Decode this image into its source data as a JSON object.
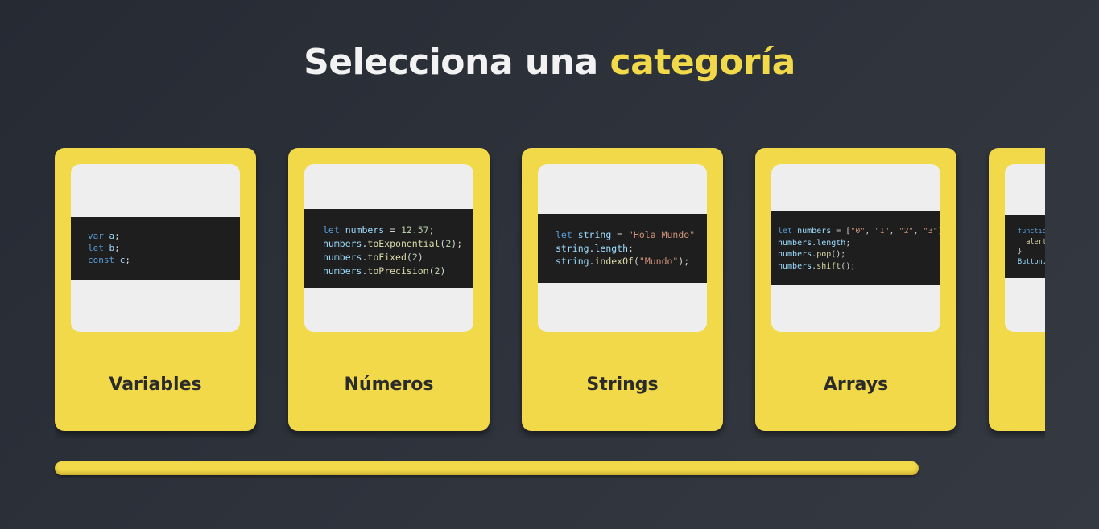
{
  "header": {
    "title_main": "Selecciona una ",
    "title_accent": "categoría"
  },
  "colors": {
    "background": "#2b2f37",
    "accent": "#f2d94a",
    "card_label": "#2b2b2b"
  },
  "categories": [
    {
      "label": "Variables",
      "code": [
        [
          {
            "t": "var",
            "c": "kw"
          },
          {
            "t": " a",
            "c": "var"
          },
          {
            "t": ";",
            "c": ""
          }
        ],
        [
          {
            "t": "let",
            "c": "kw"
          },
          {
            "t": " b",
            "c": "var"
          },
          {
            "t": ";",
            "c": ""
          }
        ],
        [
          {
            "t": "const",
            "c": "kw"
          },
          {
            "t": " c",
            "c": "var"
          },
          {
            "t": ";",
            "c": ""
          }
        ]
      ]
    },
    {
      "label": "Números",
      "code": [
        [
          {
            "t": "let",
            "c": "kw"
          },
          {
            "t": " numbers",
            "c": "var"
          },
          {
            "t": " = ",
            "c": ""
          },
          {
            "t": "12.57",
            "c": "num"
          },
          {
            "t": ";",
            "c": ""
          }
        ],
        [
          {
            "t": "numbers",
            "c": "var"
          },
          {
            "t": ".",
            "c": ""
          },
          {
            "t": "toExponential",
            "c": "fn"
          },
          {
            "t": "(",
            "c": ""
          },
          {
            "t": "2",
            "c": "num"
          },
          {
            "t": ");",
            "c": ""
          }
        ],
        [
          {
            "t": "numbers",
            "c": "var"
          },
          {
            "t": ".",
            "c": ""
          },
          {
            "t": "toFixed",
            "c": "fn"
          },
          {
            "t": "(",
            "c": ""
          },
          {
            "t": "2",
            "c": "num"
          },
          {
            "t": ")",
            "c": ""
          }
        ],
        [
          {
            "t": "numbers",
            "c": "var"
          },
          {
            "t": ".",
            "c": ""
          },
          {
            "t": "toPrecision",
            "c": "fn"
          },
          {
            "t": "(",
            "c": ""
          },
          {
            "t": "2",
            "c": "num"
          },
          {
            "t": ")",
            "c": ""
          }
        ]
      ]
    },
    {
      "label": "Strings",
      "code": [
        [
          {
            "t": "let",
            "c": "kw"
          },
          {
            "t": " string",
            "c": "var"
          },
          {
            "t": " = ",
            "c": ""
          },
          {
            "t": "\"Hola Mundo\"",
            "c": "str"
          }
        ],
        [
          {
            "t": "string",
            "c": "var"
          },
          {
            "t": ".",
            "c": ""
          },
          {
            "t": "length",
            "c": "var"
          },
          {
            "t": ";",
            "c": ""
          }
        ],
        [
          {
            "t": "string",
            "c": "var"
          },
          {
            "t": ".",
            "c": ""
          },
          {
            "t": "indexOf",
            "c": "fn"
          },
          {
            "t": "(",
            "c": ""
          },
          {
            "t": "\"Mundo\"",
            "c": "str"
          },
          {
            "t": ");",
            "c": ""
          }
        ]
      ]
    },
    {
      "label": "Arrays",
      "code": [
        [
          {
            "t": "let",
            "c": "kw"
          },
          {
            "t": " numbers",
            "c": "var"
          },
          {
            "t": " = [",
            "c": ""
          },
          {
            "t": "\"0\"",
            "c": "str"
          },
          {
            "t": ", ",
            "c": ""
          },
          {
            "t": "\"1\"",
            "c": "str"
          },
          {
            "t": ", ",
            "c": ""
          },
          {
            "t": "\"2\"",
            "c": "str"
          },
          {
            "t": ", ",
            "c": ""
          },
          {
            "t": "\"3\"",
            "c": "str"
          },
          {
            "t": "]",
            "c": ""
          }
        ],
        [
          {
            "t": "numbers",
            "c": "var"
          },
          {
            "t": ".",
            "c": ""
          },
          {
            "t": "length",
            "c": "var"
          },
          {
            "t": ";",
            "c": ""
          }
        ],
        [
          {
            "t": "numbers",
            "c": "var"
          },
          {
            "t": ".",
            "c": ""
          },
          {
            "t": "pop",
            "c": "fn"
          },
          {
            "t": "();",
            "c": ""
          }
        ],
        [
          {
            "t": "numbers",
            "c": "var"
          },
          {
            "t": ".",
            "c": ""
          },
          {
            "t": "shift",
            "c": "fn"
          },
          {
            "t": "();",
            "c": ""
          }
        ]
      ]
    },
    {
      "label": "",
      "code": [
        [
          {
            "t": "function",
            "c": "kw"
          }
        ],
        [
          {
            "t": "  alert",
            "c": "fn"
          }
        ],
        [
          {
            "t": "}",
            "c": ""
          }
        ],
        [
          {
            "t": "Button.",
            "c": "var"
          }
        ]
      ]
    }
  ]
}
